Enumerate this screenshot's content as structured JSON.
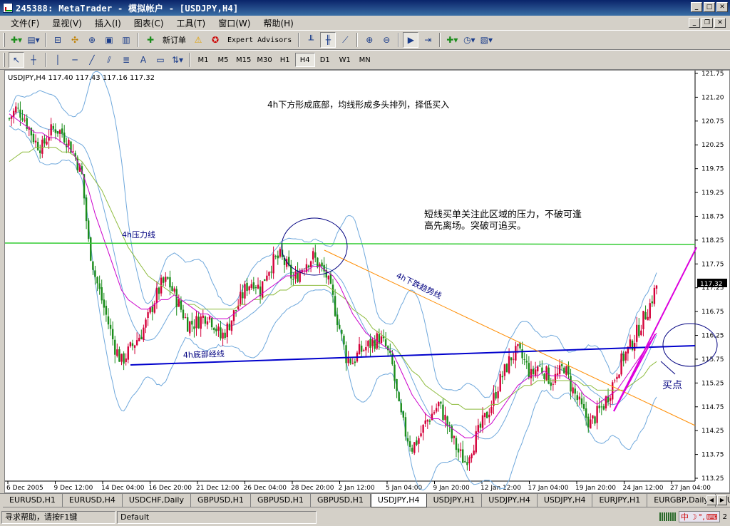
{
  "window": {
    "title": "245388: MetaTrader - 模拟帐户 - [USDJPY,H4]"
  },
  "menu": [
    "文件(F)",
    "显视(V)",
    "插入(I)",
    "图表(C)",
    "工具(T)",
    "窗口(W)",
    "帮助(H)"
  ],
  "toolbar": {
    "new_order": "新订单",
    "expert_advisors": "Expert Advisors"
  },
  "timeframes": [
    "M1",
    "M5",
    "M15",
    "M30",
    "H1",
    "H4",
    "D1",
    "W1",
    "MN"
  ],
  "active_timeframe": "H4",
  "chart_data": {
    "type": "candlestick",
    "info": "USDJPY,H4  117.40 117.43 117.16 117.32",
    "current_price": "117.32",
    "y_ticks": [
      "121.75",
      "121.20",
      "120.75",
      "120.25",
      "119.75",
      "119.25",
      "118.75",
      "118.25",
      "117.75",
      "117.25",
      "116.75",
      "116.25",
      "115.75",
      "115.25",
      "114.75",
      "114.25",
      "113.75",
      "113.25"
    ],
    "ylim": [
      113.25,
      121.75
    ],
    "x_ticks": [
      "6 Dec 2005",
      "9 Dec 12:00",
      "14 Dec 04:00",
      "16 Dec 20:00",
      "21 Dec 12:00",
      "26 Dec 04:00",
      "28 Dec 20:00",
      "2 Jan 12:00",
      "5 Jan 04:00",
      "9 Jan 20:00",
      "12 Jan 12:00",
      "17 Jan 04:00",
      "19 Jan 20:00",
      "24 Jan 12:00",
      "27 Jan 04:00"
    ],
    "price_path": [
      120.8,
      121.0,
      120.9,
      120.6,
      120.3,
      120.2,
      120.5,
      120.6,
      120.5,
      120.3,
      120.0,
      119.6,
      118.2,
      117.5,
      117.0,
      116.5,
      116.0,
      115.7,
      115.9,
      116.1,
      116.3,
      116.6,
      117.0,
      117.3,
      117.4,
      117.1,
      116.8,
      116.5,
      116.5,
      116.6,
      116.7,
      116.5,
      116.2,
      116.4,
      116.7,
      117.0,
      117.3,
      117.4,
      117.2,
      117.6,
      117.8,
      117.9,
      117.7,
      117.4,
      117.6,
      117.8,
      117.9,
      117.7,
      117.5,
      117.0,
      116.4,
      115.8,
      115.7,
      115.9,
      116.0,
      116.1,
      116.2,
      116.0,
      115.6,
      114.7,
      114.2,
      113.9,
      114.1,
      114.4,
      114.6,
      114.8,
      114.5,
      114.1,
      113.8,
      113.6,
      113.9,
      114.2,
      114.5,
      114.8,
      115.2,
      115.5,
      115.8,
      115.9,
      115.7,
      115.4,
      115.6,
      115.5,
      115.3,
      115.4,
      115.6,
      115.2,
      114.9,
      114.6,
      114.4,
      114.6,
      114.8,
      115.1,
      115.5,
      115.8,
      116.0,
      116.3,
      116.6,
      116.9,
      117.3
    ],
    "ma_fast": [
      120.9,
      120.8,
      120.7,
      120.6,
      120.5,
      120.5,
      120.4,
      120.4,
      120.3,
      120.2,
      120.0,
      119.7,
      119.3,
      118.8,
      118.4,
      118.0,
      117.6,
      117.2,
      117.0,
      116.9,
      116.8,
      116.8,
      116.9,
      117.0,
      117.0,
      117.1,
      117.0,
      116.9,
      116.8,
      116.7,
      116.7,
      116.6,
      116.6,
      116.6,
      116.7,
      116.8,
      116.9,
      117.0,
      117.1,
      117.2,
      117.3,
      117.4,
      117.5,
      117.5,
      117.6,
      117.6,
      117.7,
      117.7,
      117.6,
      117.5,
      117.3,
      117.0,
      116.7,
      116.5,
      116.3,
      116.2,
      116.1,
      116.0,
      115.9,
      115.6,
      115.3,
      115.0,
      114.8,
      114.6,
      114.5,
      114.5,
      114.4,
      114.3,
      114.2,
      114.1,
      114.1,
      114.2,
      114.3,
      114.4,
      114.6,
      114.8,
      115.0,
      115.2,
      115.3,
      115.4,
      115.4,
      115.5,
      115.4,
      115.4,
      115.4,
      115.3,
      115.2,
      115.0,
      114.9,
      114.8,
      114.9,
      115.0,
      115.1,
      115.3,
      115.5,
      115.7,
      115.9,
      116.1,
      116.3
    ],
    "ma_slow": [
      119.9,
      120.0,
      120.1,
      120.1,
      120.2,
      120.2,
      120.2,
      120.2,
      120.1,
      120.1,
      120.0,
      119.9,
      119.7,
      119.5,
      119.3,
      119.0,
      118.7,
      118.4,
      118.1,
      117.9,
      117.7,
      117.5,
      117.4,
      117.3,
      117.2,
      117.1,
      117.0,
      116.9,
      116.9,
      116.8,
      116.8,
      116.8,
      116.8,
      116.8,
      116.8,
      116.9,
      116.9,
      117.0,
      117.0,
      117.1,
      117.1,
      117.2,
      117.2,
      117.3,
      117.3,
      117.3,
      117.3,
      117.3,
      117.3,
      117.2,
      117.1,
      117.0,
      116.8,
      116.7,
      116.6,
      116.4,
      116.3,
      116.2,
      116.1,
      115.9,
      115.7,
      115.5,
      115.4,
      115.2,
      115.1,
      115.0,
      114.9,
      114.8,
      114.8,
      114.7,
      114.7,
      114.7,
      114.7,
      114.8,
      114.8,
      114.9,
      115.0,
      115.1,
      115.2,
      115.2,
      115.3,
      115.3,
      115.3,
      115.3,
      115.3,
      115.3,
      115.3,
      115.2,
      115.2,
      115.1,
      115.1,
      115.1,
      115.1,
      115.1,
      115.2,
      115.3,
      115.4,
      115.6,
      115.7
    ]
  },
  "annotations": {
    "note1": "4h下方形成底部，均线形成多头排列，择低买入",
    "note2_line1": "短线买单关注此区域的压力，不破可逢",
    "note2_line2": "高先离场。突破可追买。",
    "resistance_label": "4h压力线",
    "support_label": "4h底部经线",
    "downtrend_label": "4h下跌趋势线",
    "buy_label": "买点"
  },
  "tabs": [
    "EURUSD,H1",
    "EURUSD,H4",
    "USDCHF,Daily",
    "GBPUSD,H1",
    "GBPUSD,H1",
    "GBPUSD,H1",
    "USDJPY,H4",
    "USDJPY,H1",
    "USDJPY,H4",
    "USDJPY,H4",
    "EURJPY,H1",
    "EURGBP,Daily",
    "EU"
  ],
  "active_tab_index": 6,
  "status": {
    "help": "寻求帮助，请按F1键",
    "profile": "Default",
    "connection": "2"
  },
  "colors": {
    "up_candle": "#d4003a",
    "down_candle": "#1a8c1a",
    "bollinger": "#6fa8dc",
    "ma_fast": "#cc00cc",
    "ma_slow": "#8dbb3d",
    "resistance": "#33cc33",
    "support": "#0000cc",
    "downtrend": "#ff8c00"
  }
}
